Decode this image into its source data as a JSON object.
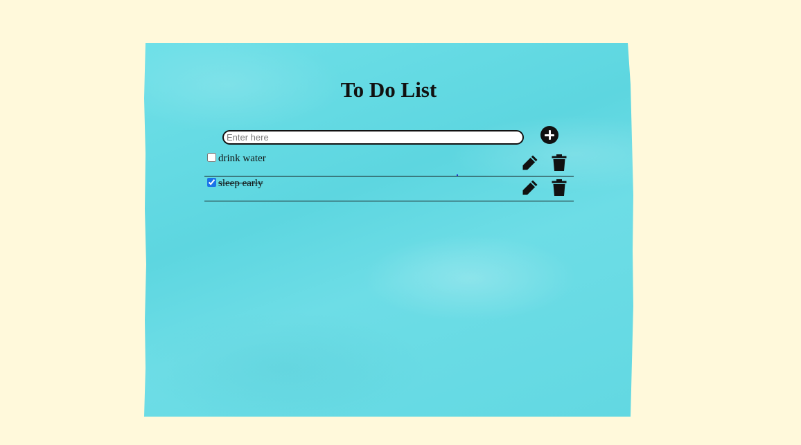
{
  "app": {
    "title": "To Do List"
  },
  "input": {
    "placeholder": "Enter here",
    "value": ""
  },
  "add_button": {
    "icon": "plus-circle-icon"
  },
  "todos": [
    {
      "text": "drink water",
      "checked": false
    },
    {
      "text": "sleep early",
      "checked": true
    }
  ],
  "row_actions": {
    "edit_icon": "pencil-icon",
    "delete_icon": "trash-icon"
  },
  "colors": {
    "page_background": "#fff9db",
    "note_background": "#62d8e2",
    "ink": "#111111",
    "checkbox_accent": "#1a73e8"
  }
}
